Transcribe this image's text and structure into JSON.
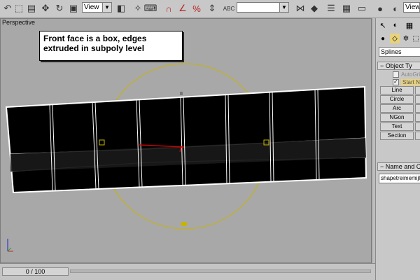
{
  "toolbar": {
    "reference_dropdown": "View",
    "view_dropdown": "View",
    "named_selection": "",
    "icons": [
      "undo-icon",
      "redo-icon",
      "select-icon",
      "select-by-name-icon",
      "move-icon",
      "rotate-icon",
      "scale-icon",
      "reference-coordinate-icon",
      "pivot-icon",
      "manipulate-icon",
      "snap-icon",
      "angle-snap-icon",
      "percent-snap-icon",
      "spinner-snap-icon",
      "edit-named-selection-icon",
      "mirror-icon",
      "align-icon",
      "layer-icon",
      "curve-editor-icon",
      "material-editor-icon",
      "render-setup-icon",
      "render-icon"
    ]
  },
  "viewport": {
    "label": "Perspective",
    "callout": "Front face is a box, edges extruded in subpoly level"
  },
  "command_panel": {
    "category_dropdown": "Splines",
    "object_type_header": "Object Ty",
    "autogrid_label": "AutoGrid",
    "start_new_label": "Start N",
    "buttons": [
      "Line",
      "Circle",
      "Arc",
      "NGon",
      "Text",
      "Section"
    ],
    "name_color_header": "Name and C",
    "name_value": "shapetreimemijloch"
  },
  "timeline": {
    "frame_display": "0 / 100"
  },
  "colors": {
    "viewport_bg": "#a8a8a8",
    "mesh_fill": "#000000",
    "gizmo": "#c8b400",
    "selection_edge": "#ffffff"
  }
}
